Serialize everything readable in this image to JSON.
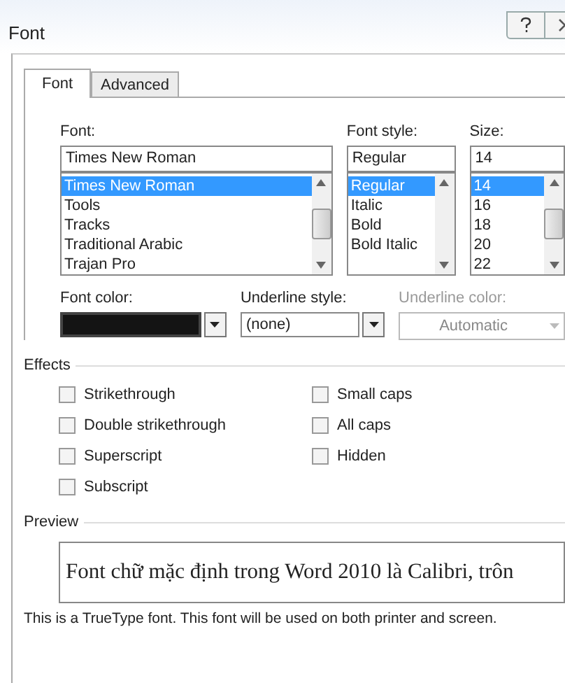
{
  "window": {
    "title": "Font"
  },
  "tabs": [
    {
      "label": "Font",
      "selected": true
    },
    {
      "label": "Advanced",
      "selected": false
    }
  ],
  "font": {
    "label": "Font:",
    "value": "Times New Roman",
    "items": [
      {
        "label": "Times New Roman",
        "selected": true
      },
      {
        "label": "Tools",
        "selected": false
      },
      {
        "label": "Tracks",
        "selected": false
      },
      {
        "label": "Traditional Arabic",
        "selected": false
      },
      {
        "label": "Trajan Pro",
        "selected": false
      }
    ]
  },
  "font_style": {
    "label": "Font style:",
    "value": "Regular",
    "items": [
      {
        "label": "Regular",
        "selected": true
      },
      {
        "label": "Italic",
        "selected": false
      },
      {
        "label": "Bold",
        "selected": false
      },
      {
        "label": "Bold Italic",
        "selected": false
      }
    ]
  },
  "size": {
    "label": "Size:",
    "value": "14",
    "items": [
      {
        "label": "14",
        "selected": true
      },
      {
        "label": "16",
        "selected": false
      },
      {
        "label": "18",
        "selected": false
      },
      {
        "label": "20",
        "selected": false
      },
      {
        "label": "22",
        "selected": false
      }
    ]
  },
  "font_color": {
    "label": "Font color:",
    "color": "#141414"
  },
  "underline_style": {
    "label": "Underline style:",
    "value": "(none)"
  },
  "underline_color": {
    "label": "Underline color:",
    "value": "Automatic",
    "disabled": true
  },
  "effects": {
    "label": "Effects",
    "left": [
      {
        "label": "Strikethrough",
        "checked": false
      },
      {
        "label": "Double strikethrough",
        "checked": false
      },
      {
        "label": "Superscript",
        "checked": false
      },
      {
        "label": "Subscript",
        "checked": false
      }
    ],
    "right": [
      {
        "label": "Small caps",
        "checked": false
      },
      {
        "label": "All caps",
        "checked": false
      },
      {
        "label": "Hidden",
        "checked": false
      }
    ]
  },
  "preview": {
    "label": "Preview",
    "text": "Font chữ mặc định trong Word 2010 là Calibri, trôn"
  },
  "note": "This is a TrueType font. This font will be used on both printer and screen."
}
